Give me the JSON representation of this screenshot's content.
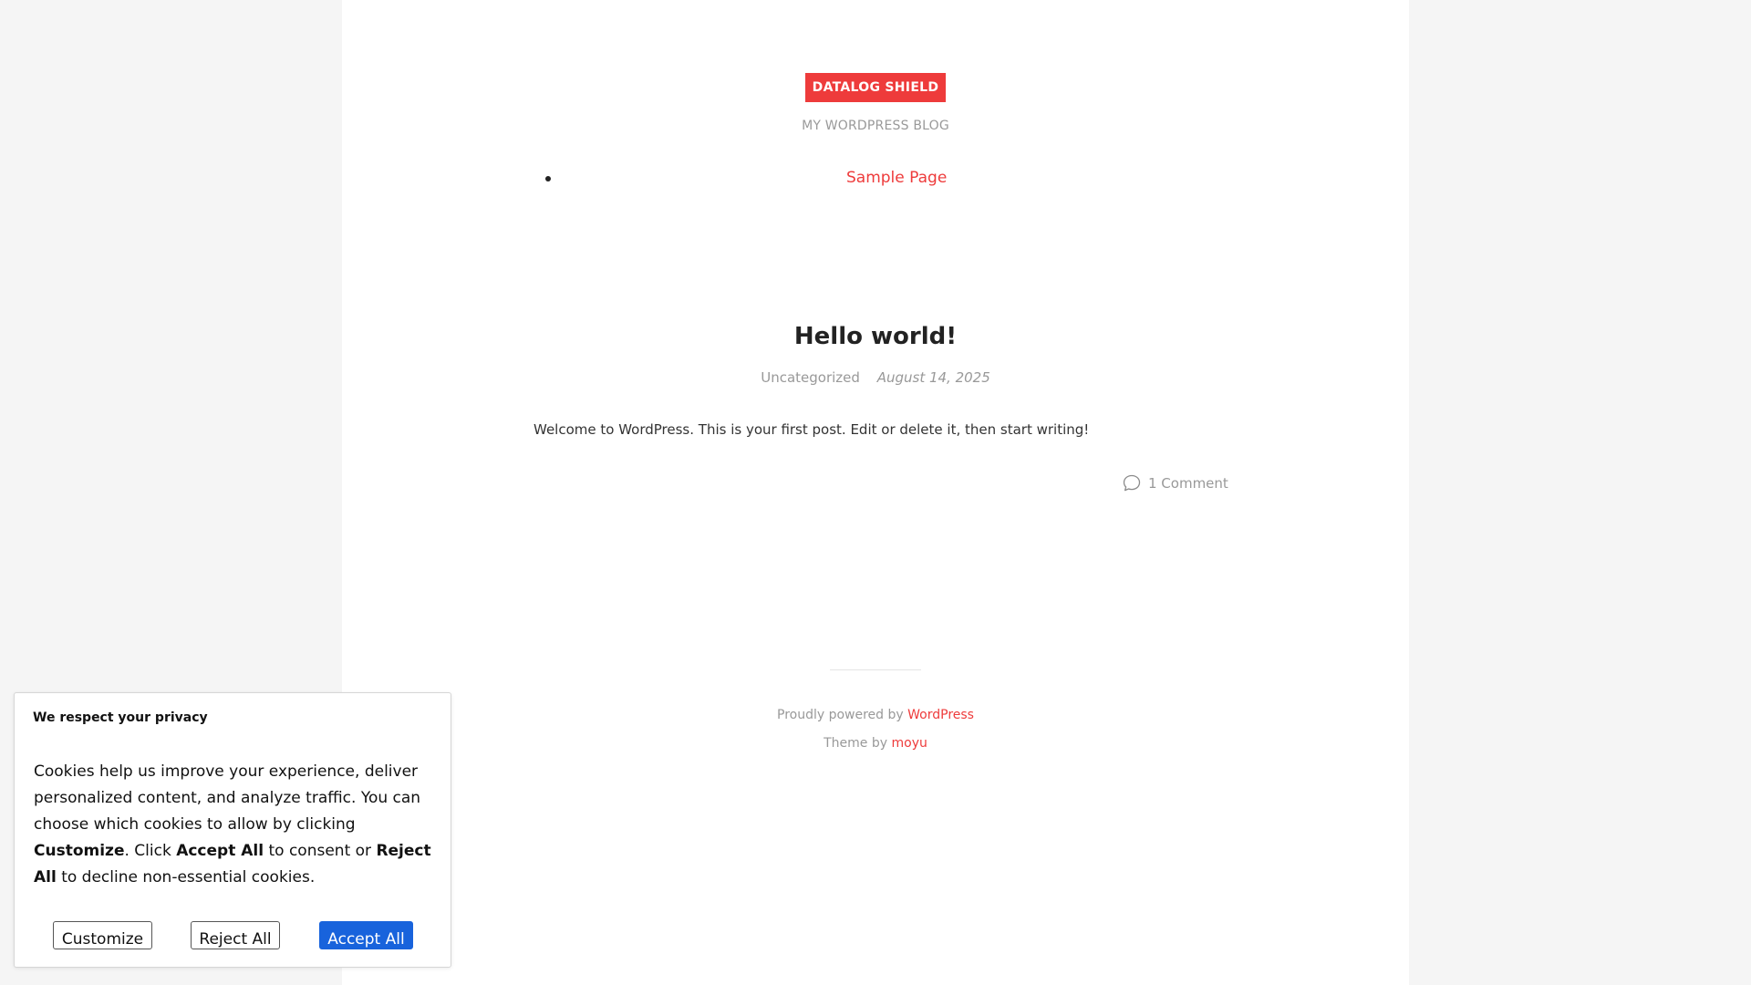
{
  "site": {
    "title": "DATALOG SHIELD",
    "tagline": "MY WORDPRESS BLOG",
    "nav": [
      {
        "label": "Sample Page"
      }
    ]
  },
  "post": {
    "title": "Hello world!",
    "category": "Uncategorized",
    "date": "August 14, 2025",
    "body": "Welcome to WordPress. This is your first post. Edit or delete it, then start writing!",
    "comments": "1 Comment"
  },
  "footer": {
    "powered_prefix": "Proudly powered by",
    "powered_link": "WordPress",
    "theme_prefix": "Theme by",
    "theme_link": "moyu"
  },
  "cookie_banner": {
    "title": "We respect your privacy",
    "text_part1": "Cookies help us improve your experience, deliver personalized content, and analyze traffic. You can choose which cookies to allow by clicking ",
    "text_bold1": "Customize",
    "text_part2": ". Click ",
    "text_bold2": "Accept All",
    "text_part3": " to consent or ",
    "text_bold3": "Reject All",
    "text_part4": " to decline non-essential cookies.",
    "customize_label": "Customize",
    "reject_label": "Reject All",
    "accept_label": "Accept All"
  },
  "colors": {
    "accent": "#ee3b3b",
    "accept_button": "#1863dc",
    "page_background": "#f5f5f5",
    "content_background": "#ffffff"
  },
  "icons": {
    "comment": "comment-bubble-icon"
  }
}
